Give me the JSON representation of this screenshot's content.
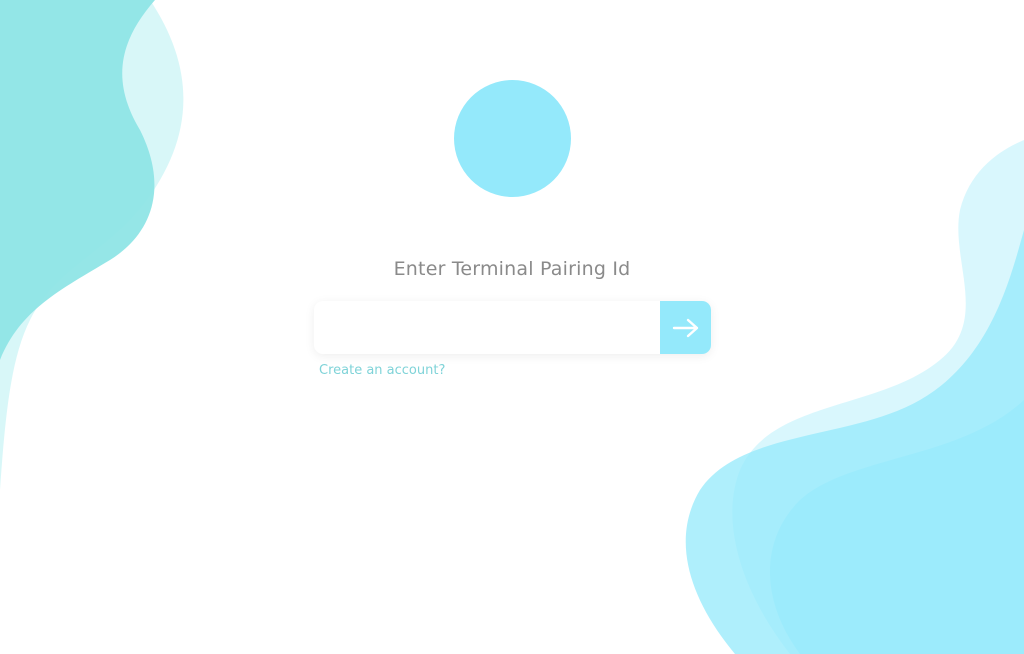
{
  "colors": {
    "accent": "#94e9fb",
    "left_blob_dark": "#8fe5e6",
    "left_blob_light": "#d6f7f8",
    "right_blob": "#94e9fb",
    "prompt_text": "#8a8a8a",
    "link_text": "#7fd3d8"
  },
  "logo": {
    "icon": "circle-logo"
  },
  "pairing": {
    "title": "Enter Terminal Pairing Id",
    "input_value": "",
    "input_placeholder": "",
    "submit_icon": "arrow-right-icon"
  },
  "links": {
    "create_account": "Create an account?"
  }
}
